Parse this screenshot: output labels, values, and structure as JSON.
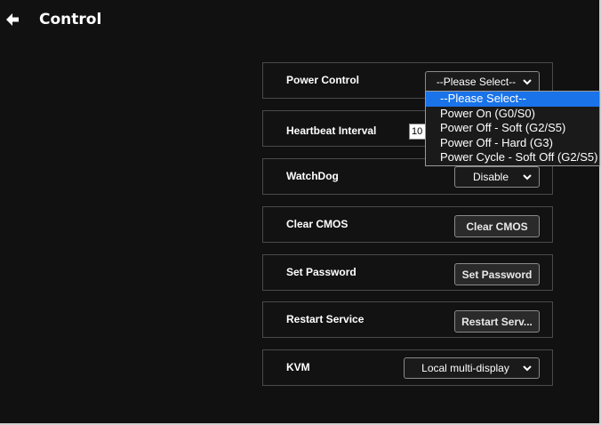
{
  "header": {
    "title": "Control",
    "back_icon": "arrow-left-icon"
  },
  "rows": [
    {
      "label": "Power Control",
      "control": "select",
      "value": "--Please Select--"
    },
    {
      "label": "Heartbeat Interval",
      "control": "input",
      "value": "10"
    },
    {
      "label": "WatchDog",
      "control": "select",
      "value": "Disable"
    },
    {
      "label": "Clear CMOS",
      "control": "button",
      "value": "Clear CMOS"
    },
    {
      "label": "Set Password",
      "control": "button",
      "value": "Set Password"
    },
    {
      "label": "Restart Service",
      "control": "button",
      "value": "Restart Serv..."
    },
    {
      "label": "KVM",
      "control": "select",
      "value": "Local multi-display"
    }
  ],
  "power_dropdown": {
    "options": [
      "--Please Select--",
      "Power On (G0/S0)",
      "Power Off - Soft (G2/S5)",
      "Power Off - Hard (G3)",
      "Power Cycle - Soft Off (G2/S5)"
    ],
    "highlighted_index": 0
  },
  "colors": {
    "background": "#111111",
    "border": "#4a4a4a",
    "highlight": "#1a73e8",
    "text": "#ffffff"
  }
}
